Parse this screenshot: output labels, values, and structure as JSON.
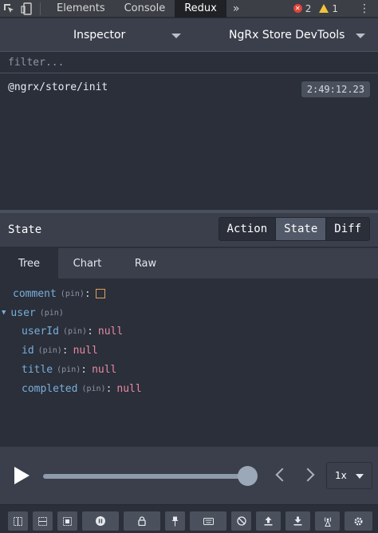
{
  "topbar": {
    "tabs": [
      "Elements",
      "Console",
      "Redux"
    ],
    "active_tab": "Redux",
    "more": "»",
    "errors": "2",
    "warnings": "1",
    "kebab": "⋮"
  },
  "header": {
    "left_select": "Inspector",
    "right_select": "NgRx Store DevTools"
  },
  "filter": {
    "placeholder": "filter..."
  },
  "actions": [
    {
      "name": "@ngrx/store/init",
      "time": "2:49:12.23"
    }
  ],
  "state_panel": {
    "title": "State",
    "tabs": [
      "Action",
      "State",
      "Diff"
    ],
    "active": "State"
  },
  "subtabs": {
    "items": [
      "Tree",
      "Chart",
      "Raw"
    ],
    "active": "Tree"
  },
  "tree": {
    "pin": "(pin)",
    "comment_key": "comment",
    "user_key": "user",
    "user_fields": [
      {
        "key": "userId",
        "value": "null"
      },
      {
        "key": "id",
        "value": "null"
      },
      {
        "key": "title",
        "value": "null"
      },
      {
        "key": "completed",
        "value": "null"
      }
    ]
  },
  "player": {
    "speed": "1x",
    "progress": 1.0
  },
  "colors": {
    "background": "#2a2f3a",
    "panel": "#3a3f4b",
    "key": "#7aaed8",
    "null": "#e78aa0",
    "error": "#e0453b",
    "warning": "#f2c33b"
  },
  "toolbar_icons": [
    "layout-horizontal-icon",
    "layout-vertical-icon",
    "layout-grid-icon",
    "pause-recording-icon",
    "lock-icon",
    "pin-icon",
    "keyboard-icon",
    "persist-icon",
    "export-icon",
    "import-icon",
    "remote-icon",
    "settings-icon"
  ]
}
